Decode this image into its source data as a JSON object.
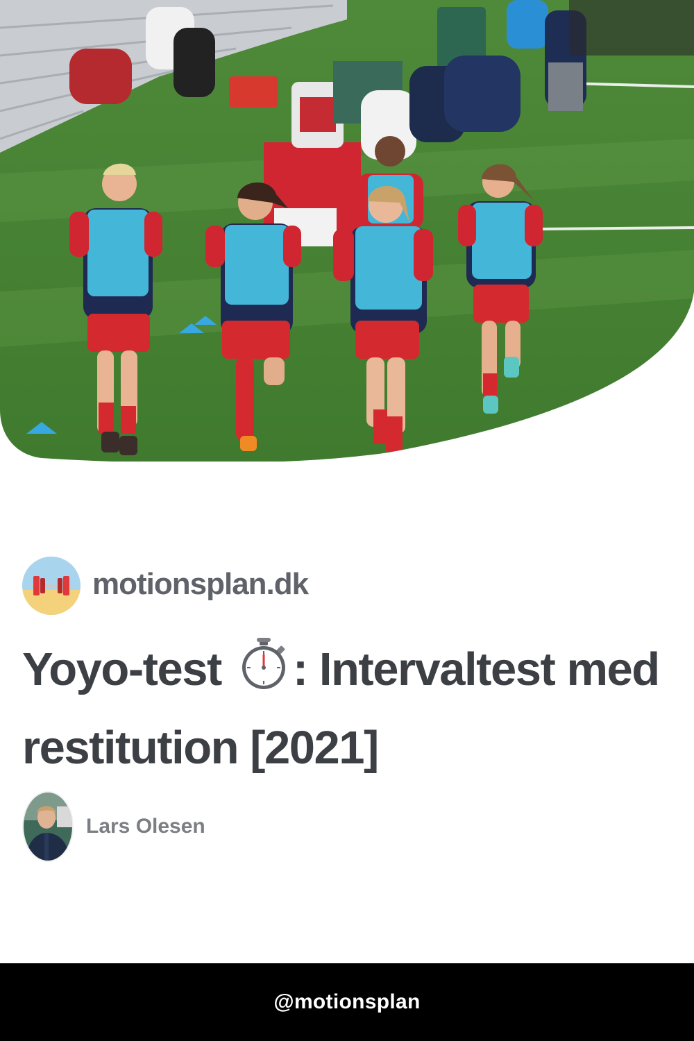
{
  "site": {
    "name": "motionsplan.dk",
    "logo_icon": "barbell-logo-icon"
  },
  "article": {
    "title_part1": "Yoyo-test",
    "title_emoji": "stopwatch-icon",
    "title_part2": ": Intervaltest med restitution [2021]"
  },
  "author": {
    "name": "Lars Olesen"
  },
  "footer": {
    "handle": "@motionsplan"
  },
  "colors": {
    "site_name": "#5f6369",
    "headline": "#3c3f44",
    "author_name": "#7b7e83",
    "footer_bg": "#000000",
    "footer_text": "#ffffff"
  }
}
